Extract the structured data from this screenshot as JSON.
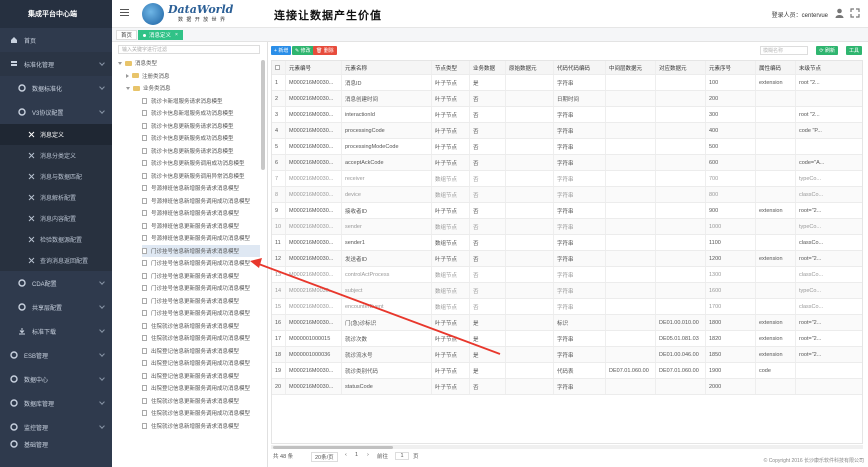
{
  "sidebar": {
    "title": "集成平台中心端",
    "items": [
      {
        "label": "首页",
        "icon": "home-icon"
      },
      {
        "label": "标准化管理",
        "icon": "layers-icon",
        "expanded": true
      },
      {
        "label": "数据标准化",
        "icon": "gear-icon",
        "sub": true
      },
      {
        "label": "V3协议配置",
        "icon": "gear-icon",
        "sub": true,
        "expanded": true
      }
    ],
    "subitems": [
      {
        "label": "消息定义",
        "active": true
      },
      {
        "label": "消息分类定义"
      },
      {
        "label": "消息与数据匹配"
      },
      {
        "label": "消息解析配置"
      },
      {
        "label": "消息内容配置"
      },
      {
        "label": "检验数据源配置"
      },
      {
        "label": "查询消息返回配置"
      }
    ],
    "lower": [
      {
        "label": "CDA配置",
        "icon": "gear-icon"
      },
      {
        "label": "共享层配置",
        "icon": "gear-icon"
      },
      {
        "label": "标准下载",
        "icon": "download-icon"
      },
      {
        "label": "ESB管理",
        "icon": "gear-icon"
      },
      {
        "label": "数据中心",
        "icon": "gear-icon"
      },
      {
        "label": "数据库管理",
        "icon": "gear-icon"
      },
      {
        "label": "监控管理",
        "icon": "gear-icon"
      },
      {
        "label": "基础管理",
        "icon": "gear-icon"
      }
    ]
  },
  "header": {
    "brand": "DataWorld",
    "brand_sub": "数 据 开 放 世 界",
    "slogan": "连接让数据产生价值",
    "login_label": "登录人员：",
    "user": "centervue"
  },
  "tabs": {
    "home": "首页",
    "active": "消息定义"
  },
  "tree": {
    "search_placeholder": "输入关键字进行过滤",
    "root": "消息类型",
    "level1": [
      "注册类消息",
      "业务类消息"
    ],
    "leaves": [
      "就诊卡新增服务请求消息模型",
      "就诊卡信息新增服务成功消息模型",
      "就诊卡信息更新服务请求消息模型",
      "就诊卡信息更新服务成功消息模型",
      "就诊卡信息更新服务请求消息模型",
      "就诊卡信息更新服务调用成功消息模型",
      "就诊卡信息更新服务调用异常消息模型",
      "号源排班信息新增服务请求消息模型",
      "号源排班信息新增服务调用成功消息模型",
      "号源排班信息新增服务请求消息模型",
      "号源排班信息更新服务请求消息模型",
      "号源排班信息更新服务调用成功消息模型",
      "门诊挂号信息新增服务请求消息模型",
      "门诊挂号信息新增服务调用成功消息模型",
      "门诊挂号信息更新服务请求消息模型",
      "门诊挂号信息更新服务调用成功消息模型",
      "门诊挂号信息更新服务请求消息模型",
      "门诊挂号信息更新服务调用成功消息模型",
      "住院就诊信息新增服务请求消息模型",
      "住院就诊信息新增服务调用成功消息模型",
      "出院登记信息新增服务请求消息模型",
      "出院登记信息新增服务调用成功消息模型",
      "出院登记信息更新服务请求消息模型",
      "出院登记信息更新服务调用成功消息模型",
      "住院就诊信息更新服务请求消息模型",
      "住院就诊信息更新服务调用成功消息模型",
      "住院就诊信息新增服务请求消息模型"
    ],
    "selected_index": 12
  },
  "toolbar": {
    "add": "新增",
    "edit": "修改",
    "delete": "删除",
    "search_placeholder": "模糊名称",
    "refresh": "刷新",
    "tool": "工具"
  },
  "grid": {
    "columns": [
      "",
      "元素编号",
      "元素名称",
      "节点类型",
      "业务数据",
      "原始数据元",
      "代码代码编码",
      "中间层数据元",
      "对应数据元",
      "元素序号",
      "属性编码",
      "末级节点"
    ],
    "rows": [
      [
        "1",
        "M000216M0030...",
        "消息ID",
        "叶子节点",
        "是",
        "",
        "字符串",
        "",
        "",
        "100",
        "extension",
        "root \"2..."
      ],
      [
        "2",
        "M000216M0030...",
        "消息创建时间",
        "叶子节点",
        "否",
        "",
        "日期时间",
        "",
        "",
        "200",
        "",
        ""
      ],
      [
        "3",
        "M000216M0030...",
        "interactionId",
        "叶子节点",
        "否",
        "",
        "字符串",
        "",
        "",
        "300",
        "",
        "root \"2..."
      ],
      [
        "4",
        "M000216M0030...",
        "processingCode",
        "叶子节点",
        "否",
        "",
        "字符串",
        "",
        "",
        "400",
        "",
        "code \"P..."
      ],
      [
        "5",
        "M000216M0030...",
        "processingModeCode",
        "叶子节点",
        "否",
        "",
        "字符串",
        "",
        "",
        "500",
        "",
        ""
      ],
      [
        "6",
        "M000216M0030...",
        "acceptAckCode",
        "叶子节点",
        "否",
        "",
        "字符串",
        "",
        "",
        "600",
        "",
        "code=\"A..."
      ],
      [
        "7",
        "M000216M0030...",
        "receiver",
        "数组节点",
        "否",
        "",
        "字符串",
        "",
        "",
        "700",
        "",
        "typeCo..."
      ],
      [
        "8",
        "M000216M0030...",
        "device",
        "数组节点",
        "否",
        "",
        "字符串",
        "",
        "",
        "800",
        "",
        "classCo..."
      ],
      [
        "9",
        "M000216M0030...",
        "接收者ID",
        "叶子节点",
        "否",
        "",
        "字符串",
        "",
        "",
        "900",
        "extension",
        "root=\"2..."
      ],
      [
        "10",
        "M000216M0030...",
        "sender",
        "数组节点",
        "否",
        "",
        "字符串",
        "",
        "",
        "1000",
        "",
        "typeCo..."
      ],
      [
        "11",
        "M000216M0030...",
        "sender1",
        "数组节点",
        "否",
        "",
        "字符串",
        "",
        "",
        "1100",
        "",
        "classCo..."
      ],
      [
        "12",
        "M000216M0030...",
        "发送者ID",
        "叶子节点",
        "否",
        "",
        "字符串",
        "",
        "",
        "1200",
        "extension",
        "root=\"2..."
      ],
      [
        "13",
        "M000216M0030...",
        "controlActProcess",
        "数组节点",
        "否",
        "",
        "字符串",
        "",
        "",
        "1300",
        "",
        "classCo..."
      ],
      [
        "14",
        "M000216M0030...",
        "subject",
        "数组节点",
        "否",
        "",
        "字符串",
        "",
        "",
        "1600",
        "",
        "typeCo..."
      ],
      [
        "15",
        "M000216M0030...",
        "encounterEvent",
        "数组节点",
        "否",
        "",
        "字符串",
        "",
        "",
        "1700",
        "",
        "classCo..."
      ],
      [
        "16",
        "M000216M0030...",
        "门(急)诊标识",
        "叶子节点",
        "是",
        "",
        "标识",
        "",
        "DE01.00.010.00",
        "1800",
        "extension",
        "root=\"2..."
      ],
      [
        "17",
        "M000001000015",
        "就诊次数",
        "叶子节点",
        "是",
        "",
        "字符串",
        "",
        "DE05.01.081.03",
        "1820",
        "extension",
        "root=\"2..."
      ],
      [
        "18",
        "M000001000036",
        "就诊流水号",
        "叶子节点",
        "是",
        "",
        "字符串",
        "",
        "DE01.00.046.00",
        "1850",
        "extension",
        "root=\"2..."
      ],
      [
        "19",
        "M000216M0030...",
        "就诊类别代码",
        "叶子节点",
        "是",
        "",
        "代码表",
        "DE07.01.060.00",
        "DE07.01.060.00",
        "1900",
        "code",
        ""
      ],
      [
        "20",
        "M000216M0030...",
        "statusCode",
        "叶子节点",
        "否",
        "",
        "字符串",
        "",
        "",
        "2000",
        "",
        ""
      ]
    ],
    "faded_rows": [
      6,
      7,
      9,
      12,
      13,
      14
    ]
  },
  "pager": {
    "total": "共 48 条",
    "per_page": "20条/页",
    "prev": "前往",
    "page": "1",
    "suffix": "页"
  },
  "copyright": "© Copyright 2016 长沙康乐软件科技有限公司"
}
